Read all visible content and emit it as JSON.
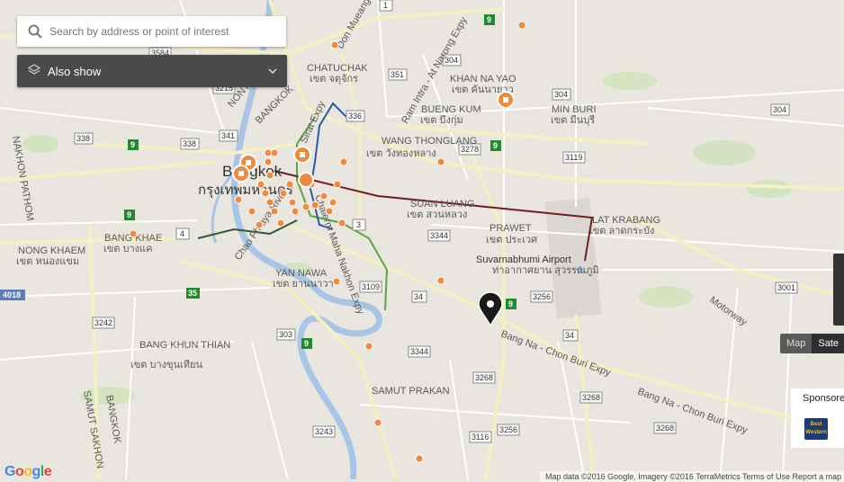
{
  "search": {
    "placeholder": "Search by address or point of interest"
  },
  "also_show": {
    "label": "Also show"
  },
  "map_type": {
    "map": "Map",
    "satellite": "Sate"
  },
  "sponsor": {
    "label": "Sponsore",
    "logo_text": "Best Western"
  },
  "attribution": {
    "logo": "Google",
    "terms": "Map data ©2016 Google, Imagery ©2016 TerraMetrics  Terms of Use  Report a map error"
  },
  "colors": {
    "road_major": "#f7f2c8",
    "road_minor": "#ffffff",
    "river": "#a8c4e6",
    "water": "#aac8ee",
    "green_line": "#5aa83c",
    "blue_line": "#2a5aa8",
    "dark_green_line": "#275c2e",
    "red_line": "#6e1f1f",
    "poi": "#f08a3c",
    "marker": "#1a1a1a"
  },
  "place_labels": [
    {
      "id": "chatuchak",
      "en": "CHATUCHAK",
      "th": "เขต จตุจักร"
    },
    {
      "id": "khan-na-yao",
      "en": "KHAN NA YAO",
      "th": "เขต คันนายาว"
    },
    {
      "id": "bueng-kum",
      "en": "BUENG KUM",
      "th": "เขต บึงกุ่ม"
    },
    {
      "id": "min-buri",
      "en": "MIN BURI",
      "th": "เขต มีนบุรี"
    },
    {
      "id": "wang-thonglang",
      "en": "WANG THONGLANG",
      "th": "เขต วังทองหลาง"
    },
    {
      "id": "bangkok",
      "en": "Bangkok",
      "th": "กรุงเทพมหานคร"
    },
    {
      "id": "suan-luang",
      "en": "SUAN LUANG",
      "th": "เขต สวนหลวง"
    },
    {
      "id": "lat-krabang",
      "en": "LAT KRABANG",
      "th": "เขต ลาดกระบัง"
    },
    {
      "id": "prawet",
      "en": "PRAWET",
      "th": "เขต ประเวศ"
    },
    {
      "id": "bang-khae",
      "en": "BANG KHAE",
      "th": "เขต บางแค"
    },
    {
      "id": "nong-khaem",
      "en": "NONG KHAEM",
      "th": "เขต หนองแขม"
    },
    {
      "id": "yan-nawa",
      "en": "YAN NAWA",
      "th": "เขต ยานนาวา"
    },
    {
      "id": "bang-khun-thian",
      "en": "BANG KHUN THIAN",
      "th": "เขต บางขุนเทียน"
    },
    {
      "id": "samut-prakan",
      "en": "SAMUT PRAKAN",
      "th": ""
    },
    {
      "id": "airport",
      "en": "Suvarnabhumi Airport",
      "th": "ท่าอากาศยาน สุวรรณภูมิ"
    }
  ],
  "road_labels": [
    "Don Mueang",
    "Ram Intra - At Narong Expy",
    "Sirat Expy",
    "Chalerm Maha Nakhon Expy",
    "Chao Phraya River",
    "Bang Na - Chon Buri Expy",
    "Bang Na - Chon Buri Expy",
    "Motorway",
    "NONTHABURI",
    "BANGKOK",
    "NAKHON PATHOM",
    "SAMUT SAKHON",
    "BANGKOK"
  ],
  "route_shields": [
    "304",
    "351",
    "336",
    "341",
    "338",
    "338",
    "3215",
    "3584",
    "3278",
    "3119",
    "304",
    "304",
    "3",
    "4",
    "3344",
    "3109",
    "34",
    "3256",
    "3001",
    "3242",
    "303",
    "3344",
    "3268",
    "3268",
    "3268",
    "3243",
    "3116",
    "3256",
    "1",
    "9",
    "9",
    "9",
    "9",
    "9",
    "35",
    "4018",
    "9"
  ]
}
